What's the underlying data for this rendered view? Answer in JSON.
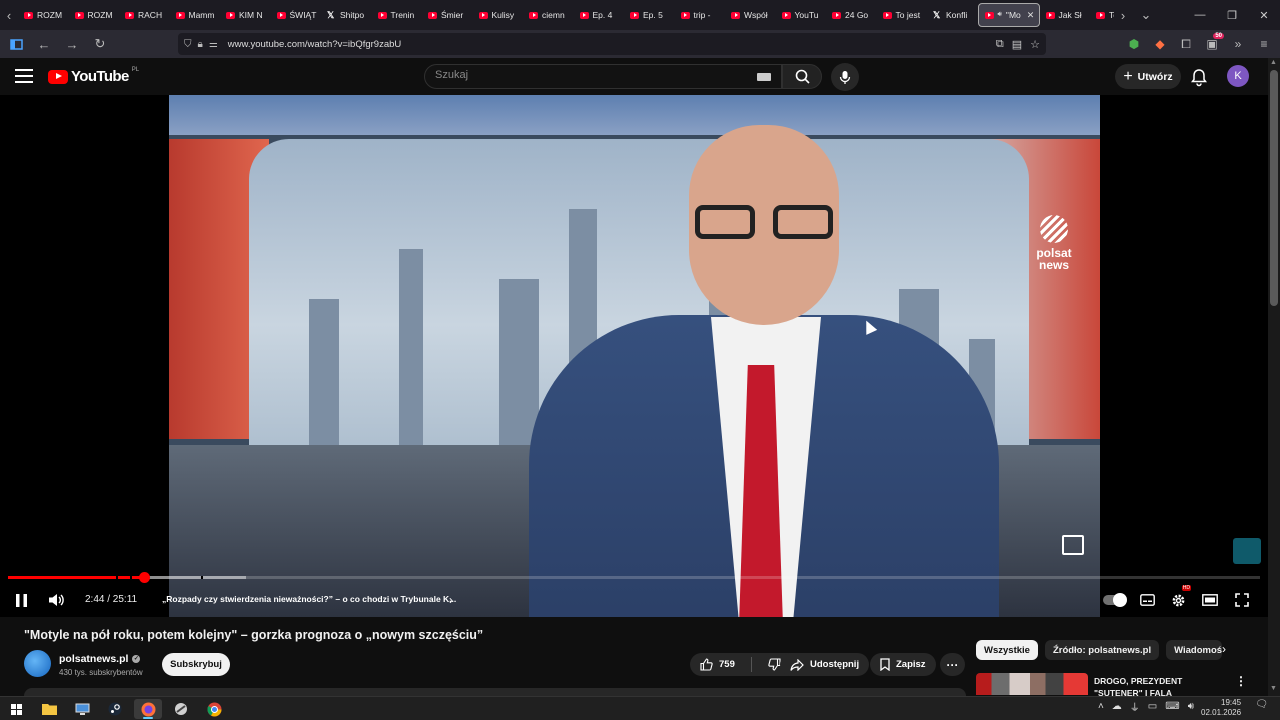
{
  "browser": {
    "tabs": [
      {
        "label": "ROZM",
        "favicon": "youtube-icon"
      },
      {
        "label": "ROZM",
        "favicon": "youtube-icon"
      },
      {
        "label": "RACH",
        "favicon": "youtube-icon"
      },
      {
        "label": "Mamm",
        "favicon": "youtube-icon"
      },
      {
        "label": "KIM N",
        "favicon": "youtube-icon"
      },
      {
        "label": "ŚWIĄT",
        "favicon": "youtube-icon"
      },
      {
        "label": "Shitpo",
        "favicon": "x-icon"
      },
      {
        "label": "Trenin",
        "favicon": "youtube-icon"
      },
      {
        "label": "Śmier",
        "favicon": "youtube-icon"
      },
      {
        "label": "Kulisy",
        "favicon": "youtube-icon"
      },
      {
        "label": "ciemn",
        "favicon": "youtube-icon"
      },
      {
        "label": "Ep. 4",
        "favicon": "youtube-icon"
      },
      {
        "label": "Ep. 5",
        "favicon": "youtube-icon"
      },
      {
        "label": "trip -",
        "favicon": "youtube-icon"
      },
      {
        "label": "Współ",
        "favicon": "youtube-icon"
      },
      {
        "label": "YouTu",
        "favicon": "youtube-icon"
      },
      {
        "label": "24 Go",
        "favicon": "youtube-icon"
      },
      {
        "label": "To jest",
        "favicon": "youtube-icon"
      },
      {
        "label": "Konfli",
        "favicon": "x-icon"
      },
      {
        "label": "\"Mo",
        "favicon": "youtube-icon",
        "active": true
      },
      {
        "label": "Jak Sł",
        "favicon": "youtube-icon"
      },
      {
        "label": "To je",
        "favicon": "youtube-icon"
      }
    ],
    "url": "www.youtube.com/watch?v=ibQfgr9zabU",
    "extension_badge": "50"
  },
  "youtube": {
    "logo_text": "YouTube",
    "country_code": "PL",
    "search_placeholder": "Szukaj",
    "create_label": "Utwórz",
    "avatar_letter": "K"
  },
  "player": {
    "current_time": "2:44",
    "duration": "25:11",
    "time_display": "2:44 / 25:11",
    "progress_fraction": 0.1086,
    "buffered_fraction": 0.19,
    "chapter_title": "„Rozpady czy stwierdzenia nieważności?” – o co chodzi w Trybunale K...",
    "channel_logo_text": [
      "polsat",
      "news"
    ],
    "hd_badge": "HD"
  },
  "video": {
    "title": "\"Motyle na pół roku, potem kolejny\" – gorzka prognoza o „nowym szczęściu”",
    "channel_name": "polsatnews.pl",
    "subscribers": "430 tys. subskrybentów",
    "subscribe_label": "Subskrybuj",
    "likes": "759",
    "share_label": "Udostępnij",
    "save_label": "Zapisz"
  },
  "sidebar": {
    "chips": [
      "Wszystkie",
      "Źródło: polsatnews.pl",
      "Wiadomości"
    ],
    "recommendation_title": "DROGO, PREZYDENT \"SUTENER\" I FALA UKRAIŃCÓ..."
  },
  "taskbar": {
    "time": "19:45",
    "date": "02.01.2026"
  },
  "colors": {
    "youtube_red": "#ff0000",
    "background": "#0f0f0f",
    "avatar": "#7e57c2"
  }
}
